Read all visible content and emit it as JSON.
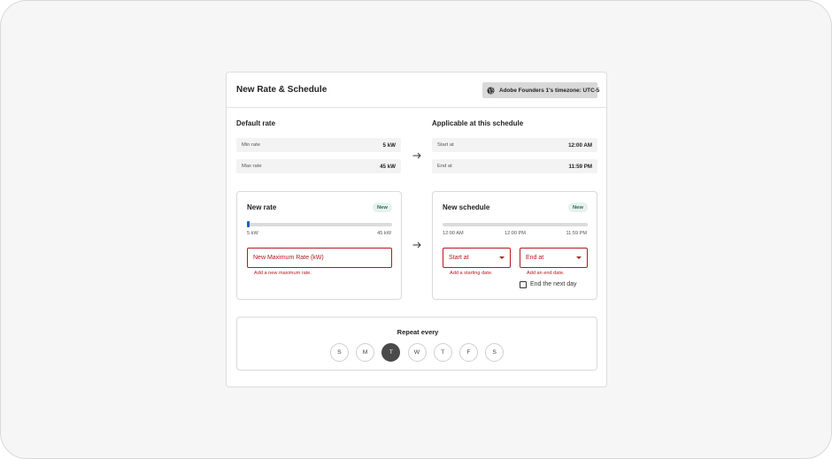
{
  "header": {
    "title": "New Rate & Schedule",
    "timezone_label": "Adobe Founders 1's timezone: UTC-5",
    "timezone_icon": "globe-icon"
  },
  "default_rate": {
    "title": "Default rate",
    "rows": [
      {
        "key": "Min rate",
        "value": "5 kW"
      },
      {
        "key": "Max rate",
        "value": "45 kW"
      }
    ]
  },
  "applicable": {
    "title": "Applicable at this schedule",
    "rows": [
      {
        "key": "Start at",
        "value": "12:00 AM"
      },
      {
        "key": "End at",
        "value": "11:59 PM"
      }
    ]
  },
  "new_rate": {
    "title": "New rate",
    "badge": "New",
    "slider_min_label": "5 kW",
    "slider_max_label": "45 kW",
    "slider_value_fraction": 0.0,
    "input_placeholder": "New Maximum Rate (kW)",
    "error": "Add a new maximum rate."
  },
  "new_schedule": {
    "title": "New schedule",
    "badge": "New",
    "timeline_labels": [
      "12:00 AM",
      "12:00 PM",
      "11:59 PM"
    ],
    "start_select": "Start at",
    "start_error": "Add a starting date.",
    "end_select": "End at",
    "end_error": "Add an end date.",
    "end_next_day_label": "End the next day",
    "end_next_day_checked": false
  },
  "repeat": {
    "title": "Repeat every",
    "days": [
      {
        "label": "S",
        "selected": false
      },
      {
        "label": "M",
        "selected": false
      },
      {
        "label": "T",
        "selected": true
      },
      {
        "label": "W",
        "selected": false
      },
      {
        "label": "T",
        "selected": false
      },
      {
        "label": "F",
        "selected": false
      },
      {
        "label": "S",
        "selected": false
      }
    ]
  },
  "colors": {
    "error": "#b3181e",
    "slider_handle": "#1b5fcf",
    "badge_bg": "#e6f3ec",
    "selected_day": "#4a4a4a"
  }
}
